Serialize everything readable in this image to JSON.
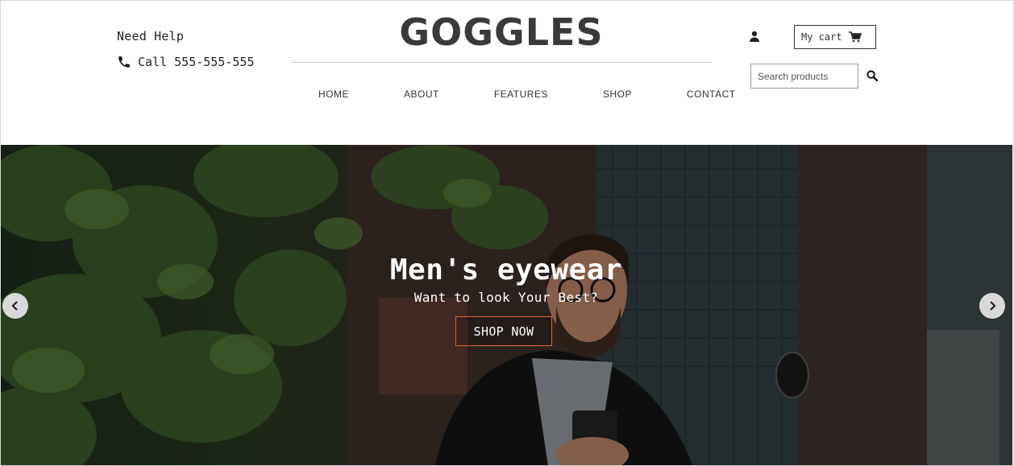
{
  "header": {
    "help_title": "Need Help",
    "call_label": "Call 555-555-555",
    "logo": "GOGGLES",
    "nav": [
      {
        "label": "HOME"
      },
      {
        "label": "ABOUT"
      },
      {
        "label": "FEATURES"
      },
      {
        "label": "SHOP"
      },
      {
        "label": "CONTACT"
      }
    ],
    "cart_label": "My cart",
    "search_placeholder": "Search products"
  },
  "hero": {
    "title": "Men's eyewear",
    "subtitle": "Want to look Your Best?",
    "cta_label": "SHOP NOW"
  },
  "icons": {
    "phone": "phone-icon",
    "user": "user-icon",
    "cart": "cart-icon",
    "search": "search-icon",
    "prev": "chevron-left-icon",
    "next": "chevron-right-icon"
  },
  "colors": {
    "logo": "#3a3a3a",
    "cta_border": "#e0643a",
    "arrow_bg": "#d9d9d9"
  }
}
